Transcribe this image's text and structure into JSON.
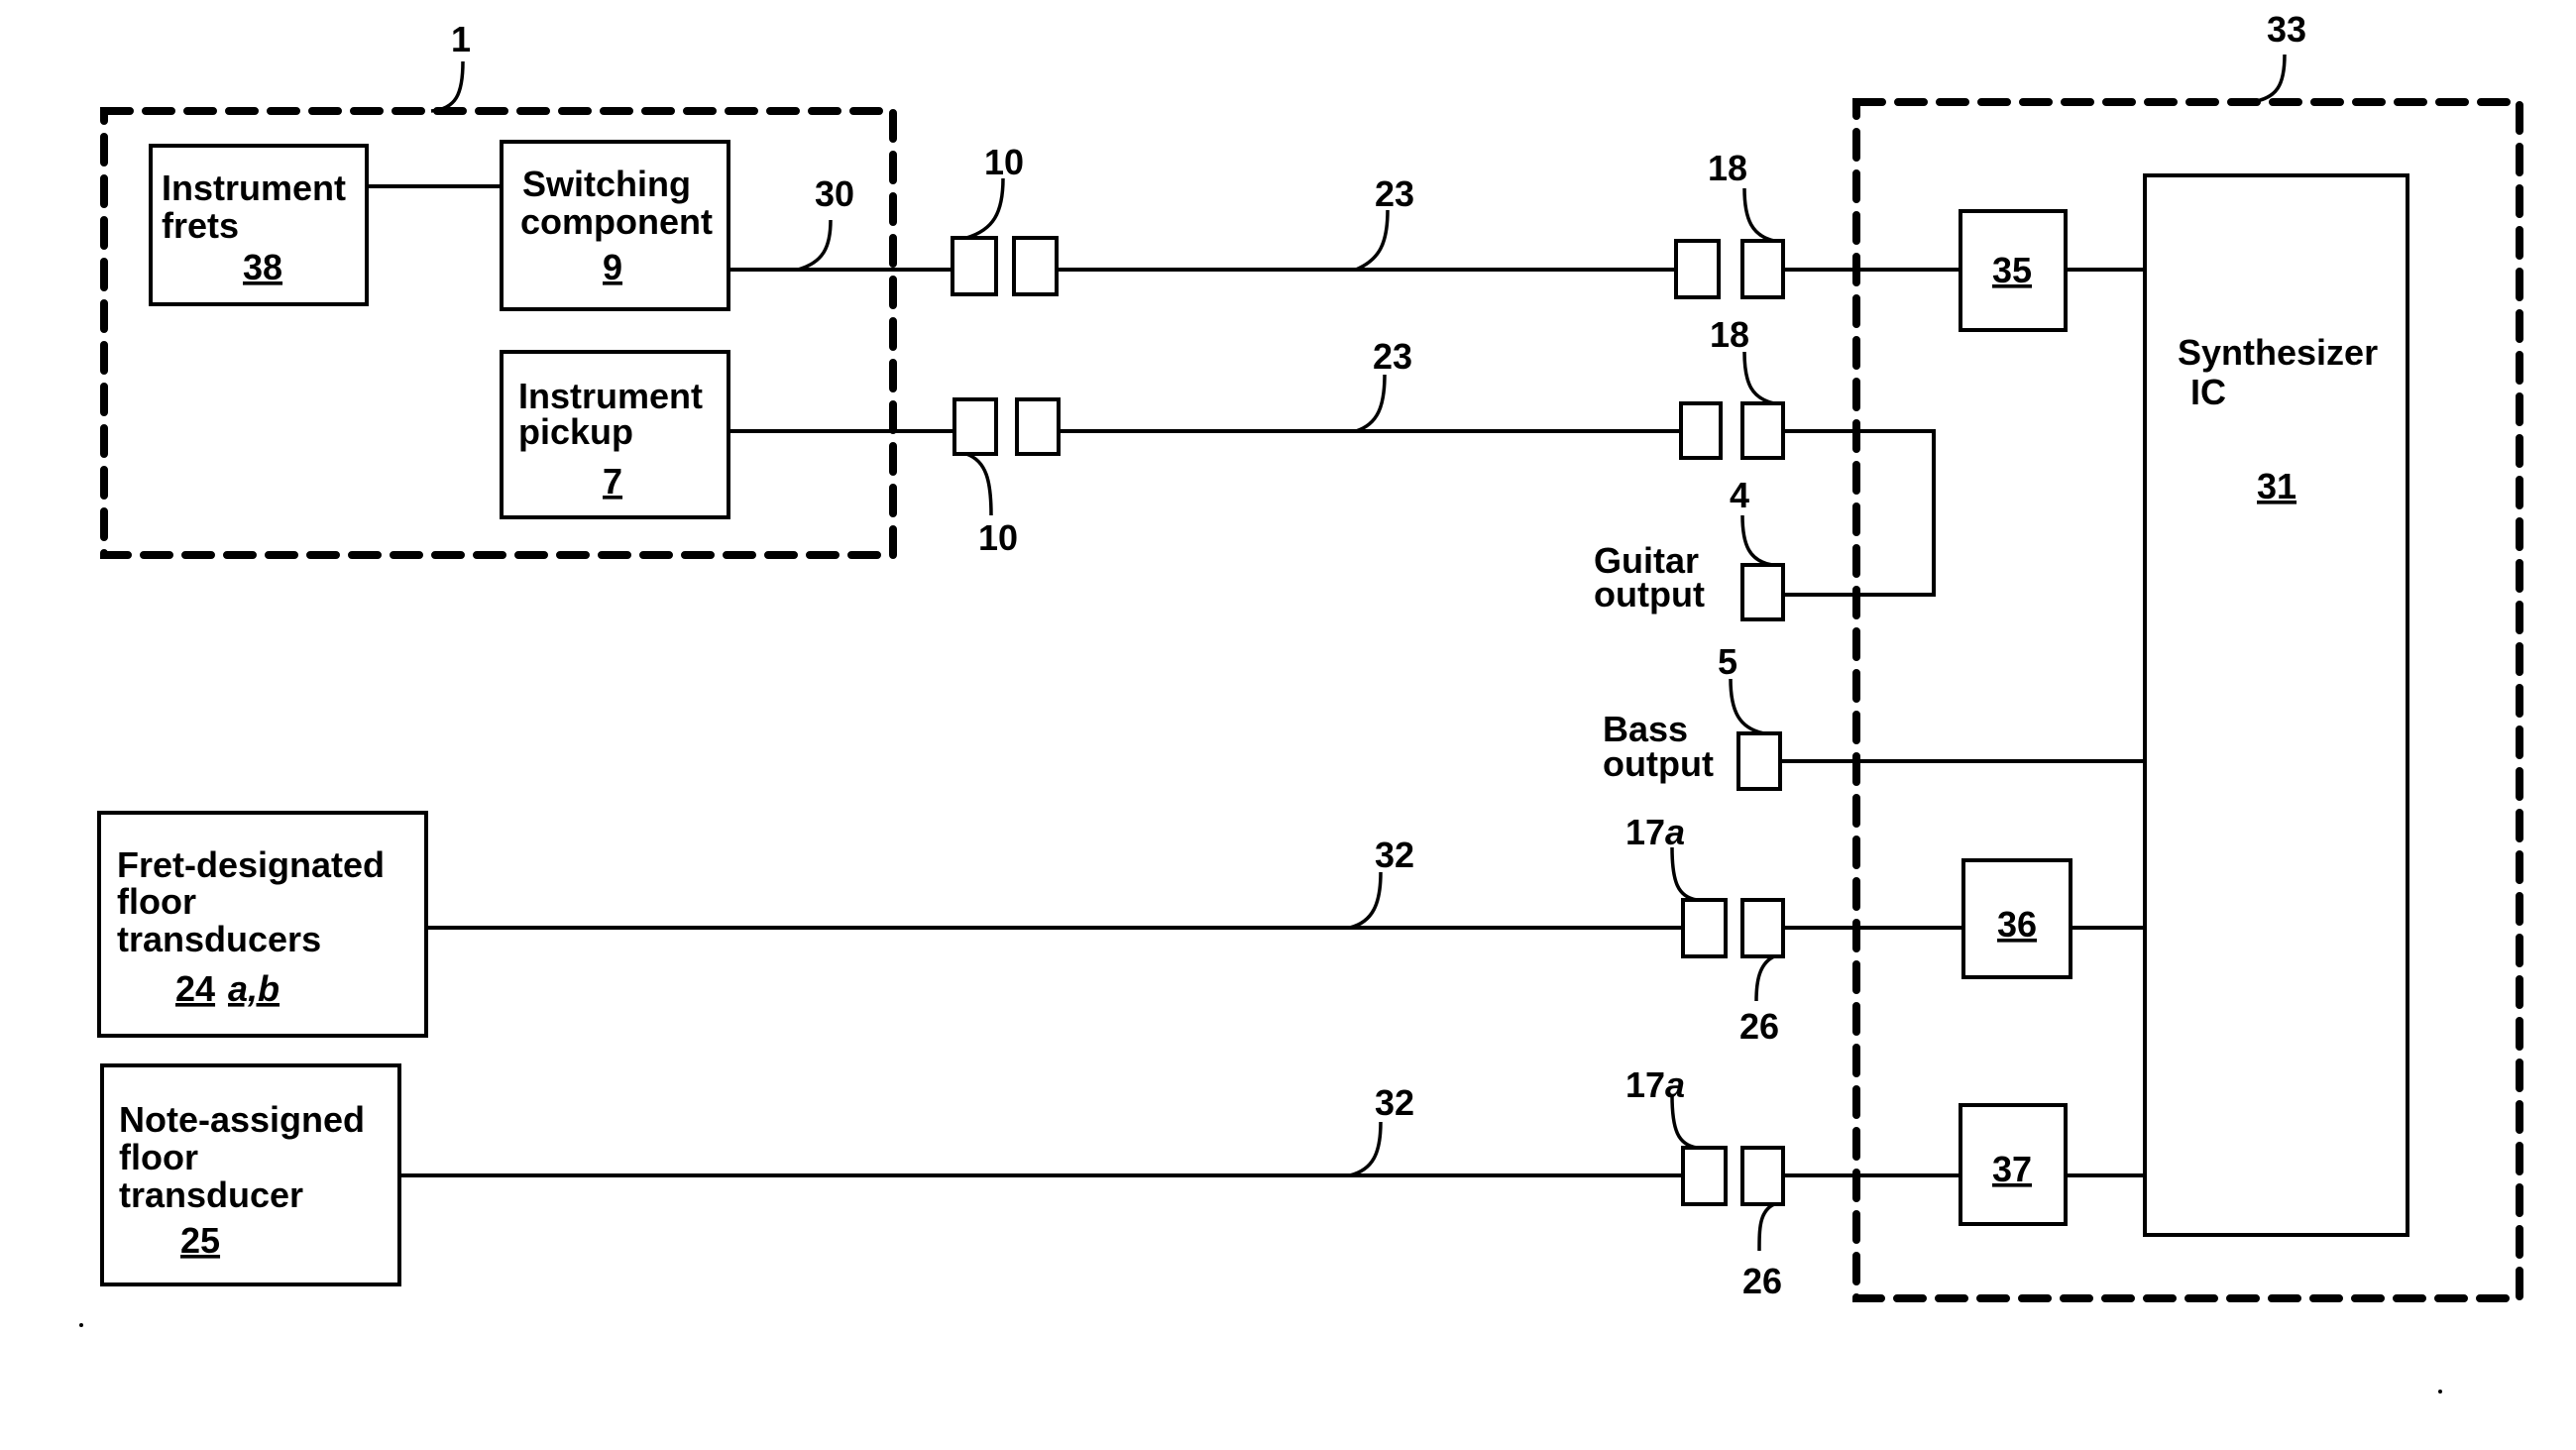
{
  "figure": {
    "instrument_group": {
      "ref": "1"
    },
    "synth_unit_group": {
      "ref": "33"
    },
    "blocks": {
      "instrument_frets": {
        "lines": [
          "Instrument",
          "frets"
        ],
        "ref": "38"
      },
      "switching_component": {
        "lines": [
          "Switching",
          "component"
        ],
        "ref": "9"
      },
      "instrument_pickup": {
        "lines": [
          "Instrument",
          "pickup"
        ],
        "ref": "7"
      },
      "fret_floor_transducers": {
        "lines": [
          "Fret-designated",
          "floor",
          "transducers"
        ],
        "ref": "24",
        "ref_suffix": "a,b"
      },
      "note_floor_transducer": {
        "lines": [
          "Note-assigned",
          "floor",
          "transducer"
        ],
        "ref": "25"
      },
      "synthesizer_ic": {
        "lines": [
          "Synthesizer",
          "IC"
        ],
        "ref": "31"
      },
      "block_35": {
        "ref": "35"
      },
      "block_36": {
        "ref": "36"
      },
      "block_37": {
        "ref": "37"
      }
    },
    "outputs": {
      "guitar": {
        "lines": [
          "Guitar",
          "output"
        ],
        "ref": "4"
      },
      "bass": {
        "lines": [
          "Bass",
          "output"
        ],
        "ref": "5"
      }
    },
    "callouts": {
      "line_30": "30",
      "connector_10_top": "10",
      "connector_10_bottom": "10",
      "cable_23_top": "23",
      "cable_23_bottom": "23",
      "connector_18_top": "18",
      "connector_18_bottom": "18",
      "cable_32_top": "32",
      "cable_32_bottom": "32",
      "connector_17a_top": {
        "num": "17",
        "suffix": "a"
      },
      "connector_17a_bottom": {
        "num": "17",
        "suffix": "a"
      },
      "connector_26_top": "26",
      "connector_26_bottom": "26"
    }
  }
}
